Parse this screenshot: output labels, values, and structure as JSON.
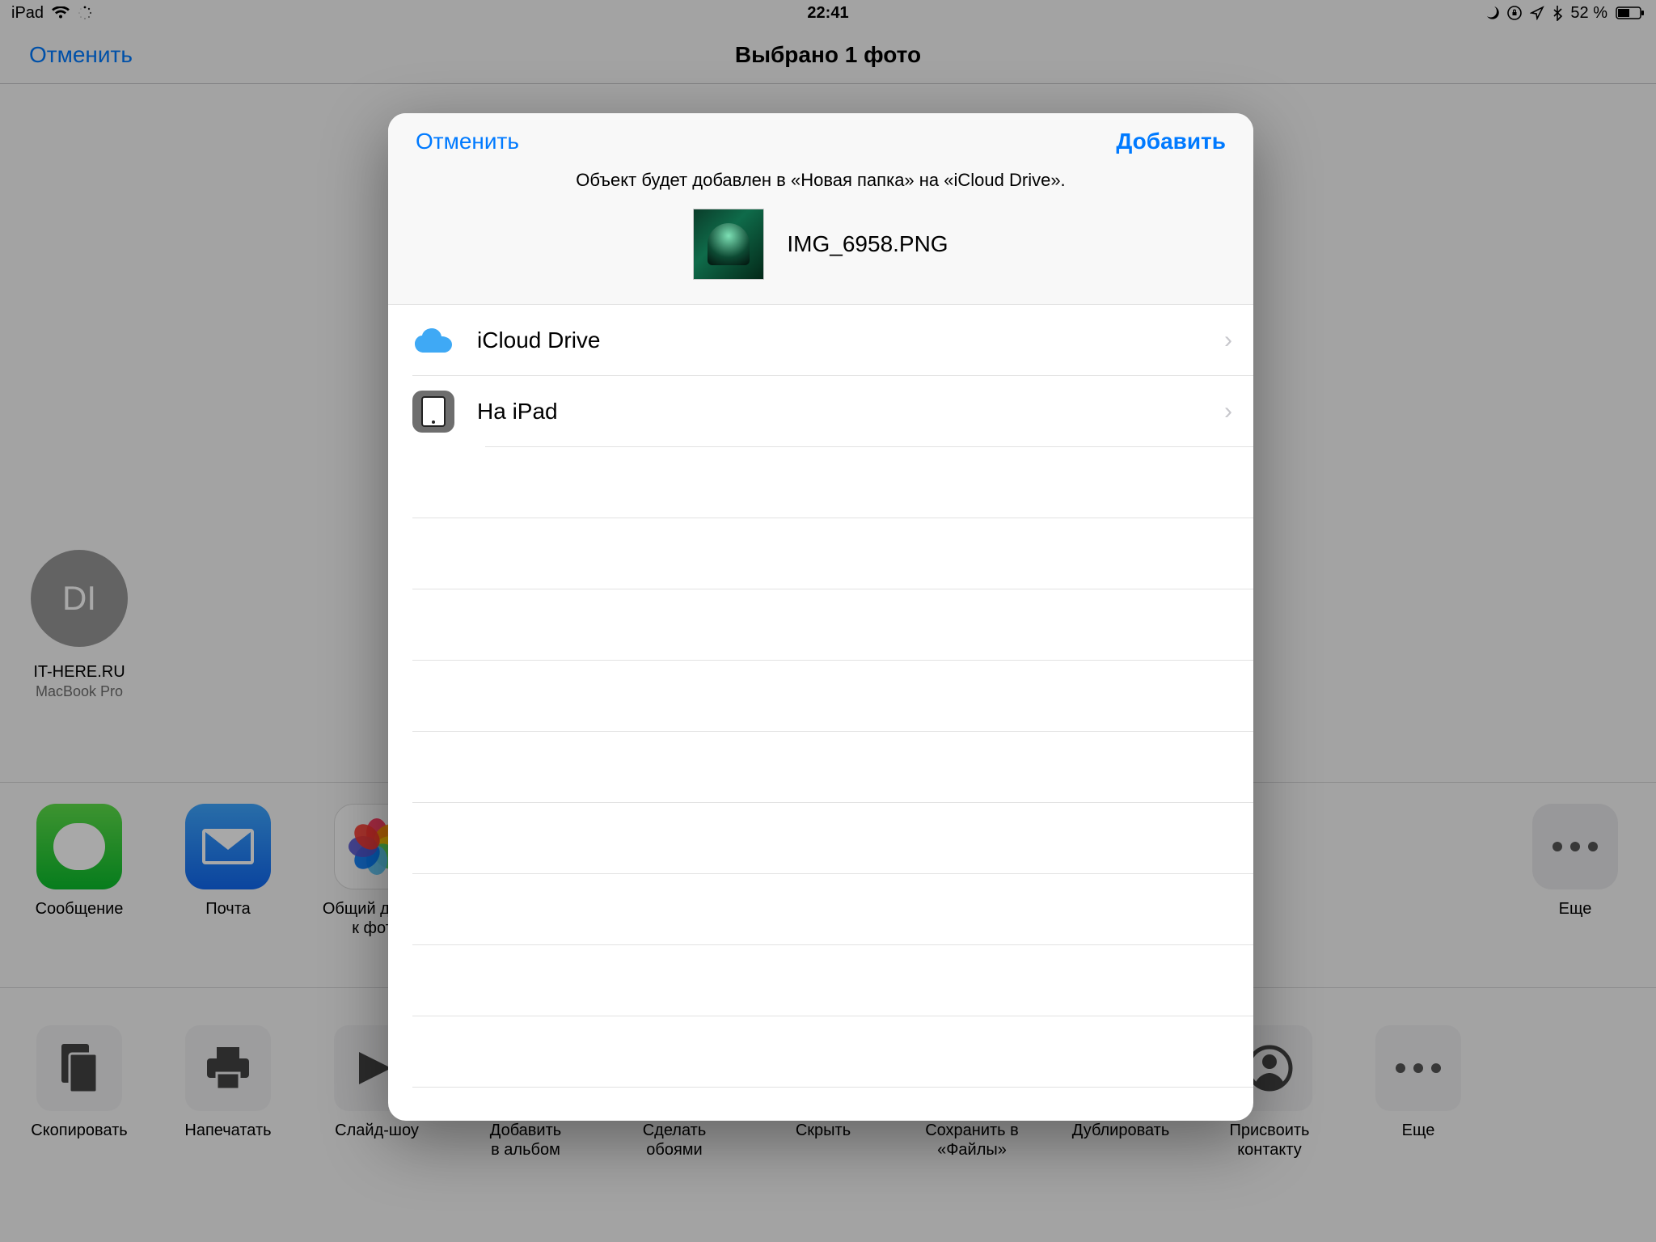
{
  "statusbar": {
    "device": "iPad",
    "time": "22:41",
    "battery_pct": "52 %"
  },
  "navbar": {
    "cancel": "Отменить",
    "title": "Выбрано 1 фото"
  },
  "airdrop": {
    "avatar_initials": "DI",
    "name": "IT-HERE.RU",
    "sub": "MacBook Pro"
  },
  "apps": {
    "message": "Сообщение",
    "mail": "Почта",
    "shared": "Общий доступ\nк фото",
    "more": "Еще"
  },
  "actions": {
    "copy": "Скопировать",
    "print": "Напечатать",
    "slideshow": "Слайд-шоу",
    "addalbum": "Добавить\nв альбом",
    "wallpaper": "Сделать\nобоями",
    "hide": "Скрыть",
    "savefiles": "Сохранить в\n«Файлы»",
    "duplicate": "Дублировать",
    "assign": "Присвоить\nконтакту",
    "more": "Еще"
  },
  "modal": {
    "cancel": "Отменить",
    "add": "Добавить",
    "message": "Объект будет добавлен в «Новая папка» на «iCloud Drive».",
    "filename": "IMG_6958.PNG",
    "locations": [
      {
        "label": "iCloud Drive"
      },
      {
        "label": "На iPad"
      }
    ]
  }
}
